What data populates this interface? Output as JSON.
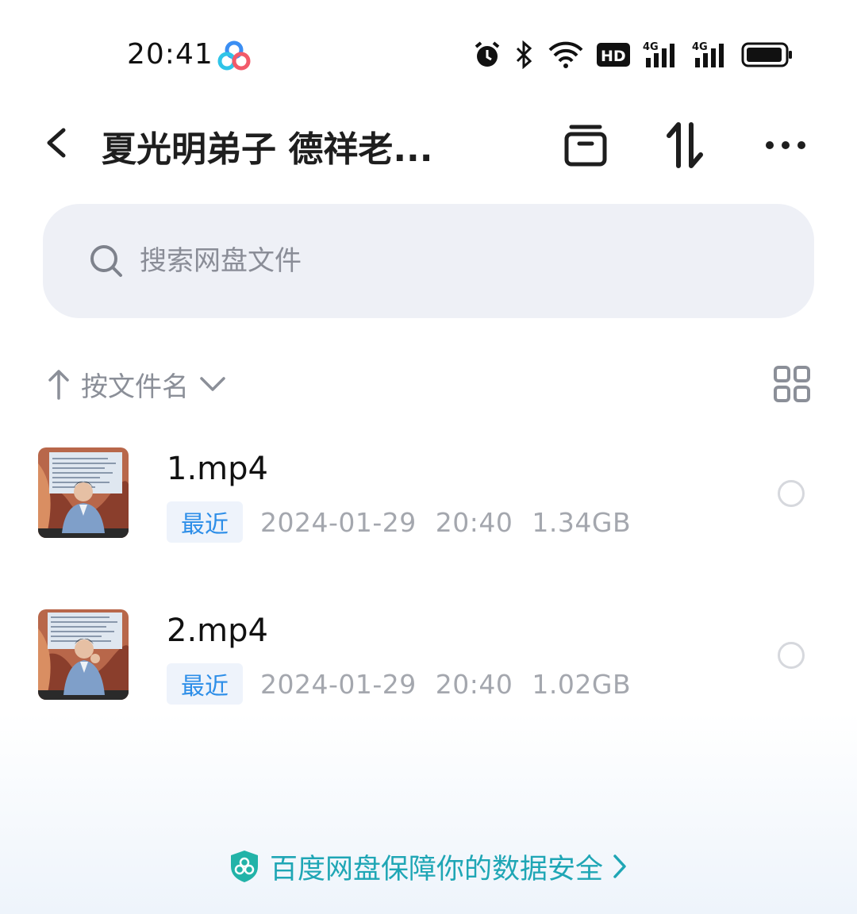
{
  "status_bar": {
    "time": "20:41",
    "app_icon": "baidu-netdisk-icon",
    "icons": [
      "alarm-icon",
      "bluetooth-icon",
      "wifi-icon",
      "hd-icon",
      "signal-4g-icon",
      "signal-4g-icon",
      "battery-icon"
    ],
    "hd_label": "HD",
    "net1": "4G",
    "net2": "4G"
  },
  "header": {
    "title": "夏光明弟子 德祥老..."
  },
  "search": {
    "placeholder": "搜索网盘文件"
  },
  "sort": {
    "label": "按文件名"
  },
  "files": [
    {
      "name": "1.mp4",
      "badge": "最近",
      "date": "2024-01-29",
      "time": "20:40",
      "size": "1.34GB"
    },
    {
      "name": "2.mp4",
      "badge": "最近",
      "date": "2024-01-29",
      "time": "20:40",
      "size": "1.02GB"
    }
  ],
  "footer": {
    "text": "百度网盘保障你的数据安全"
  },
  "colors": {
    "accent": "#2d8ee8",
    "footer_text": "#1fa6b5",
    "search_bg": "#eef0f6",
    "muted": "#a4a7ae"
  }
}
